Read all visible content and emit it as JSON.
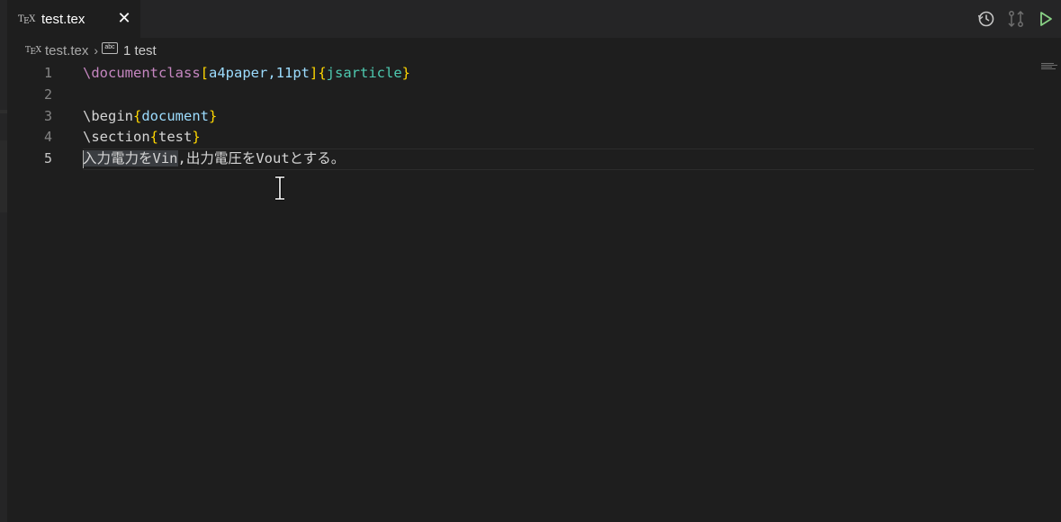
{
  "tab": {
    "icon": "tex-file-icon",
    "title": "test.tex",
    "close_icon": "close-icon"
  },
  "actions": [
    {
      "name": "timeline-icon"
    },
    {
      "name": "source-control-compare-icon"
    },
    {
      "name": "run-icon"
    }
  ],
  "breadcrumb": {
    "file": "test.tex",
    "symbol_icon": "abc-section-icon",
    "symbol": "1 test"
  },
  "editor": {
    "line_numbers": [
      "1",
      "2",
      "3",
      "4",
      "5"
    ],
    "active_line": 5,
    "lines": [
      {
        "kw": "\\documentclass",
        "b1": "[",
        "opt": "a4paper,11pt",
        "b2": "]",
        "b3": "{",
        "cls": "jsarticle",
        "b4": "}"
      },
      {},
      {
        "kw": "\\begin",
        "b1": "{",
        "arg": "document",
        "b2": "}"
      },
      {
        "kw": "\\section",
        "b1": "{",
        "arg": "test",
        "b2": "}"
      },
      {
        "selected": "入力電力をVin",
        "rest": ",出力電圧をVoutとする。"
      }
    ]
  },
  "colors": {
    "background": "#1e1e1e",
    "keyword": "#c586c0",
    "bracket": "#ffd700",
    "argument": "#9cdcfe",
    "class": "#4ec9b0",
    "run_icon": "#89d185"
  }
}
